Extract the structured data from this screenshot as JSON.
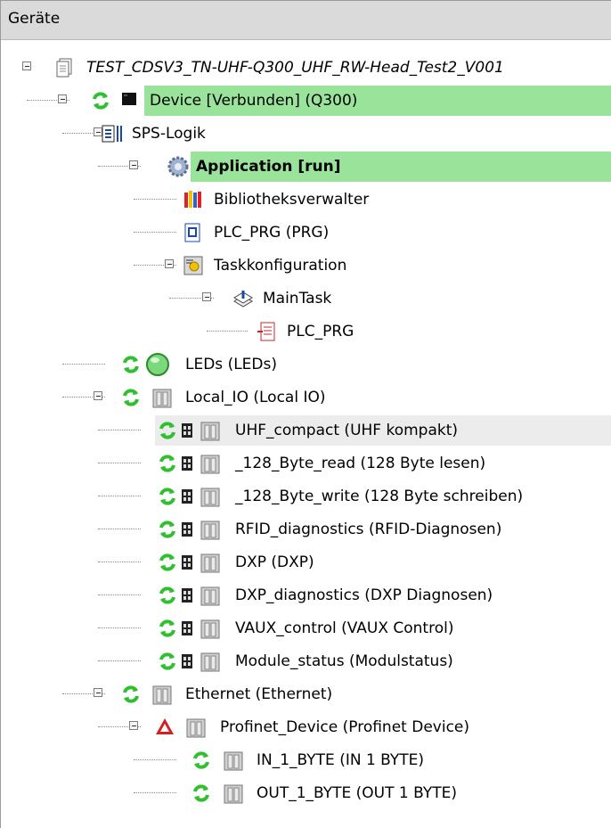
{
  "panel": {
    "title": "Geräte"
  },
  "tree": [
    {
      "label": "TEST_CDSV3_TN-UHF-Q300_UHF_RW-Head_Test2_V001",
      "icon": "project-icon",
      "status": "none",
      "style": "italic"
    },
    {
      "label": "Device [Verbunden] (Q300)",
      "icon": "device-icon",
      "status": "connected",
      "highlight": "green"
    },
    {
      "label": "SPS-Logik",
      "icon": "plc-logic-icon",
      "status": "none"
    },
    {
      "label": "Application [run]",
      "icon": "application-gear-icon",
      "status": "none",
      "style": "bold",
      "highlight": "green"
    },
    {
      "label": "Bibliotheksverwalter",
      "icon": "library-manager-icon",
      "status": "none"
    },
    {
      "label": "PLC_PRG (PRG)",
      "icon": "pou-icon",
      "status": "none"
    },
    {
      "label": "Taskkonfiguration",
      "icon": "task-config-icon",
      "status": "none"
    },
    {
      "label": "MainTask",
      "icon": "task-icon",
      "status": "none"
    },
    {
      "label": "PLC_PRG",
      "icon": "program-call-icon",
      "status": "none"
    },
    {
      "label": "LEDs (LEDs)",
      "icon": "led-icon",
      "status": "connected"
    },
    {
      "label": "Local_IO (Local IO)",
      "icon": "module-icon",
      "status": "connected"
    },
    {
      "label": "UHF_compact (UHF kompakt)",
      "icon": "module-icon",
      "status": "connected",
      "highlight": "grey"
    },
    {
      "label": "_128_Byte_read (128 Byte lesen)",
      "icon": "module-icon",
      "status": "connected"
    },
    {
      "label": "_128_Byte_write (128 Byte schreiben)",
      "icon": "module-icon",
      "status": "connected"
    },
    {
      "label": "RFID_diagnostics (RFID-Diagnosen)",
      "icon": "module-icon",
      "status": "connected"
    },
    {
      "label": "DXP (DXP)",
      "icon": "module-icon",
      "status": "connected"
    },
    {
      "label": "DXP_diagnostics (DXP Diagnosen)",
      "icon": "module-icon",
      "status": "connected"
    },
    {
      "label": "VAUX_control (VAUX Control)",
      "icon": "module-icon",
      "status": "connected"
    },
    {
      "label": "Module_status (Modulstatus)",
      "icon": "module-icon",
      "status": "connected"
    },
    {
      "label": "Ethernet (Ethernet)",
      "icon": "module-icon",
      "status": "connected"
    },
    {
      "label": "Profinet_Device (Profinet Device)",
      "icon": "module-icon",
      "status": "warning"
    },
    {
      "label": "IN_1_BYTE (IN 1 BYTE)",
      "icon": "module-icon",
      "status": "connected"
    },
    {
      "label": "OUT_1_BYTE (OUT 1 BYTE)",
      "icon": "module-icon",
      "status": "connected"
    }
  ],
  "colors": {
    "highlight_green": "#9ae39a",
    "highlight_grey": "#ececec",
    "status_green": "#2fbf2f",
    "warning_red": "#d21f1f"
  }
}
